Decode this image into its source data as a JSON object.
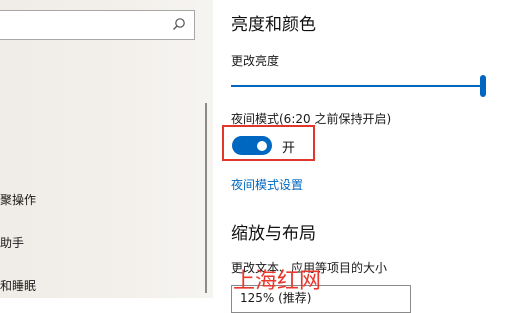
{
  "sidebar": {
    "items": [
      {
        "label": "聚操作"
      },
      {
        "label": "助手"
      },
      {
        "label": "和睡眠"
      }
    ]
  },
  "brightness": {
    "heading": "亮度和颜色",
    "slider_label": "更改亮度",
    "slider_value_fraction": 0.99
  },
  "night_light": {
    "label": "夜间模式(6:20 之前保持开启)",
    "toggle_state": "开",
    "settings_link": "夜间模式设置"
  },
  "scale": {
    "heading": "缩放与布局",
    "text_size_label": "更改文本、应用等项目的大小",
    "dropdown_value": "125% (推荐)"
  },
  "watermark": {
    "text": "上海红网"
  },
  "colors": {
    "accent": "#0067c0",
    "highlight": "#e0362b"
  }
}
